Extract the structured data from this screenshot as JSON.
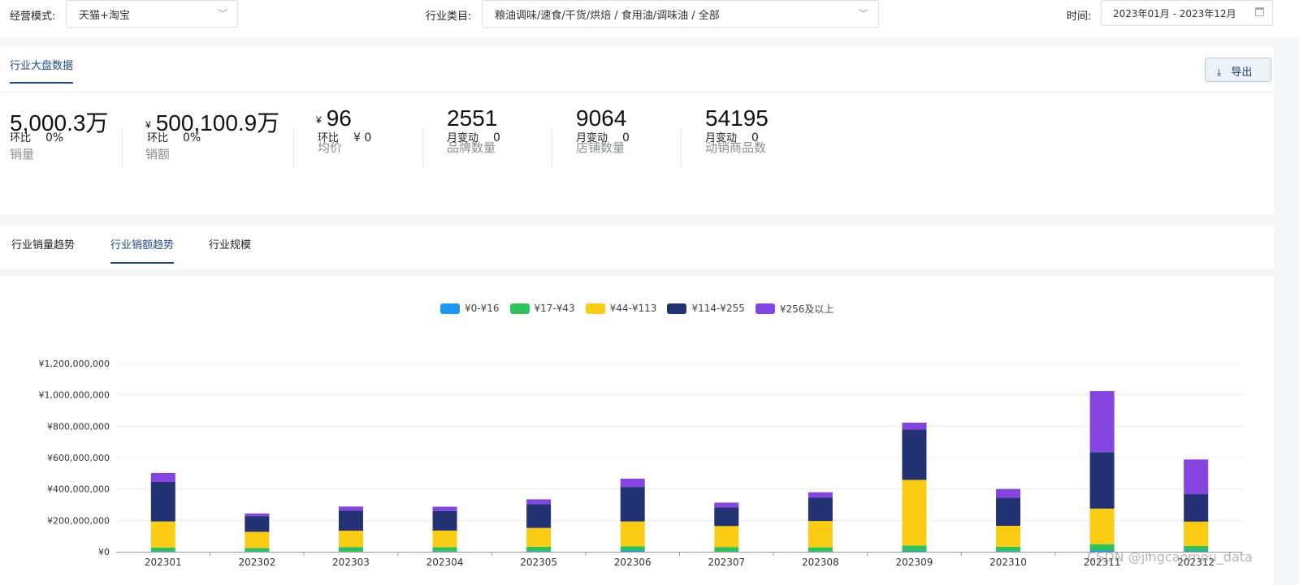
{
  "filters": {
    "mode_label": "经营模式:",
    "mode_value": "天猫+淘宝",
    "category_label": "行业类目:",
    "category_value": "粮油调味/速食/干货/烘焙 / 食用油/调味油 / 全部",
    "time_label": "时间:",
    "time_value": "2023年01月 - 2023年12月"
  },
  "overview": {
    "tab_label": "行业大盘数据",
    "export_label": "导出",
    "metrics": [
      {
        "value": "5,⁠⁠⁠⁠000.3万",
        "currency": "",
        "label": "销量",
        "change_label": "环比",
        "change_value": "0%"
      },
      {
        "value": "500,100.9万",
        "currency": "¥",
        "label": "销额",
        "change_label": "环比",
        "change_value": "0%"
      },
      {
        "value": "96",
        "currency": "¥",
        "label": "均价",
        "change_label": "环比",
        "change_value": "¥ 0"
      },
      {
        "value": "2551",
        "currency": "",
        "label": "品牌数量",
        "change_label": "月变动",
        "change_value": "0"
      },
      {
        "value": "9064",
        "currency": "",
        "label": "店铺数量",
        "change_label": "月变动",
        "change_value": "0"
      },
      {
        "value": "54195",
        "currency": "",
        "label": "动销商品数",
        "change_label": "月变动",
        "change_value": "0"
      }
    ]
  },
  "trend_tabs": [
    {
      "label": "行业销量趋势",
      "active": false
    },
    {
      "label": "行业销额趋势",
      "active": true
    },
    {
      "label": "行业规模",
      "active": false
    }
  ],
  "watermark": "CSDN @jingcaomou_data",
  "chart_data": {
    "type": "bar",
    "stacked": true,
    "categories": [
      "202301",
      "202302",
      "202303",
      "202304",
      "202305",
      "202306",
      "202307",
      "202308",
      "202309",
      "202310",
      "202311",
      "202312"
    ],
    "ylim": [
      0,
      1200000000
    ],
    "yticks": [
      "¥0",
      "¥200,000,000",
      "¥400,000,000",
      "¥600,000,000",
      "¥800,000,000",
      "¥1,000,000,000",
      "¥1,200,000,000"
    ],
    "legend_position": "top-center",
    "series": [
      {
        "name": "¥0-¥16",
        "color": "#2196f3",
        "values": [
          3000000,
          2000000,
          2000000,
          2000000,
          3000000,
          8000000,
          2000000,
          2000000,
          5000000,
          3000000,
          8000000,
          5000000
        ]
      },
      {
        "name": "¥17-¥43",
        "color": "#2fc25b",
        "values": [
          24000000,
          22000000,
          28000000,
          27000000,
          29000000,
          27000000,
          28000000,
          26000000,
          35000000,
          29000000,
          40000000,
          32000000
        ]
      },
      {
        "name": "¥44-¥113",
        "color": "#facc14",
        "values": [
          166000000,
          103000000,
          104000000,
          106000000,
          120000000,
          158000000,
          134000000,
          168000000,
          418000000,
          133000000,
          227000000,
          155000000
        ]
      },
      {
        "name": "¥114-¥255",
        "color": "#223273",
        "values": [
          252000000,
          100000000,
          127000000,
          125000000,
          151000000,
          220000000,
          119000000,
          150000000,
          322000000,
          180000000,
          360000000,
          175000000
        ]
      },
      {
        "name": "¥256及以上",
        "color": "#8543e0",
        "values": [
          57000000,
          17000000,
          27000000,
          27000000,
          31000000,
          53000000,
          30000000,
          33000000,
          43000000,
          55000000,
          389000000,
          221000000
        ]
      }
    ]
  }
}
